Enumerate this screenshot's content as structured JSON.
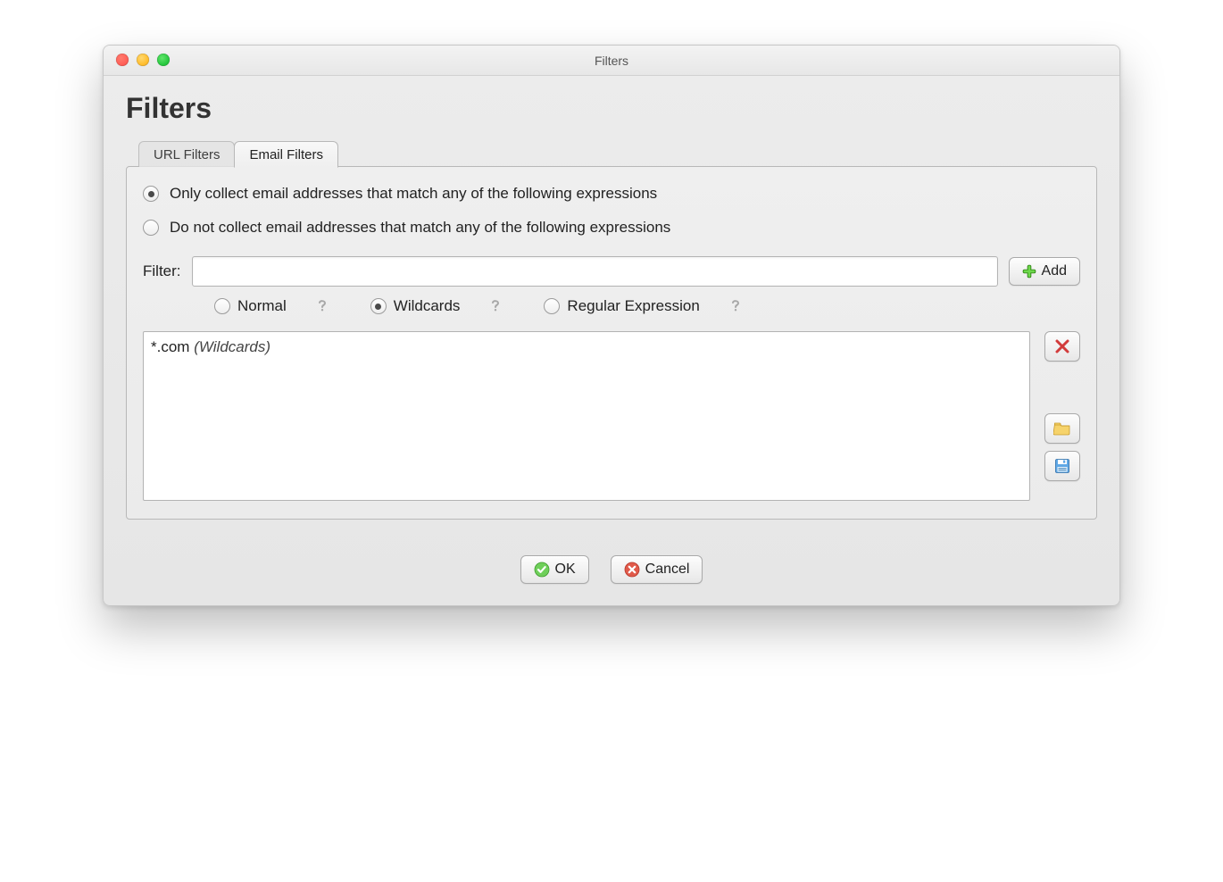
{
  "window": {
    "title": "Filters"
  },
  "page": {
    "heading": "Filters"
  },
  "tabs": {
    "url": {
      "label": "URL Filters",
      "active": false
    },
    "email": {
      "label": "Email Filters",
      "active": true
    }
  },
  "collectMode": {
    "only": {
      "label": "Only collect email addresses that match any of the following expressions",
      "selected": true
    },
    "exclude": {
      "label": "Do not collect email addresses that match any of the following expressions",
      "selected": false
    }
  },
  "filterRow": {
    "label": "Filter:",
    "value": "",
    "addLabel": "Add"
  },
  "syntax": {
    "normal": {
      "label": "Normal",
      "selected": false
    },
    "wildcards": {
      "label": "Wildcards",
      "selected": true
    },
    "regex": {
      "label": "Regular Expression",
      "selected": false
    }
  },
  "filters": [
    {
      "pattern": "*.com",
      "modeLabel": "(Wildcards)"
    }
  ],
  "footer": {
    "ok": "OK",
    "cancel": "Cancel"
  }
}
